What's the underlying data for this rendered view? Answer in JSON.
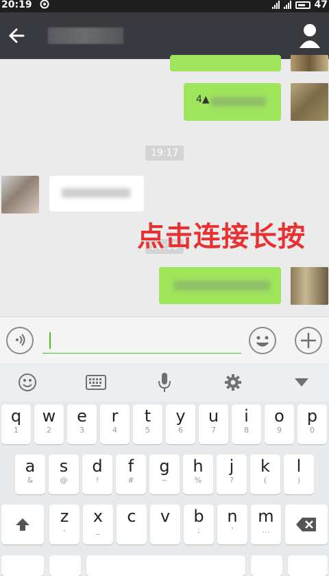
{
  "status_bar": {
    "time": "20:19",
    "battery": "47",
    "left_icon": "circle-loop-icon",
    "signal_icons": [
      "wifi-signal-icon",
      "cell-signal-icon"
    ],
    "battery_icon": "battery-icon"
  },
  "nav": {
    "back_icon": "arrow-left-icon",
    "title": "",
    "profile_icon": "person-icon"
  },
  "chat": {
    "sent_text_1": "4▲",
    "timestamps": [
      "19:17",
      "20:19"
    ],
    "overlay_annotation": "点击连接长按"
  },
  "input_bar": {
    "voice_icon": "voice-icon",
    "emoji_icon": "emoji-icon",
    "plus_icon": "plus-icon",
    "text_value": ""
  },
  "keyboard_toolbar": {
    "icons": [
      "emoji-icon",
      "keyboard-icon",
      "microphone-icon",
      "gear-icon",
      "collapse-icon"
    ]
  },
  "keyboard": {
    "row1": [
      [
        "q",
        "1"
      ],
      [
        "w",
        "2"
      ],
      [
        "e",
        "3"
      ],
      [
        "r",
        "4"
      ],
      [
        "t",
        "5"
      ],
      [
        "y",
        "6"
      ],
      [
        "u",
        "7"
      ],
      [
        "i",
        "8"
      ],
      [
        "o",
        "9"
      ],
      [
        "p",
        "0"
      ]
    ],
    "row2": [
      [
        "a",
        "&"
      ],
      [
        "s",
        "@"
      ],
      [
        "d",
        "!"
      ],
      [
        "f",
        "#"
      ],
      [
        "g",
        "~"
      ],
      [
        "h",
        "%"
      ],
      [
        "j",
        "?"
      ],
      [
        "k",
        "("
      ],
      [
        "l",
        ")"
      ]
    ],
    "row3": [
      [
        "z",
        "-"
      ],
      [
        "x",
        "_"
      ],
      [
        "c",
        ""
      ],
      [
        "v",
        ""
      ],
      [
        "b",
        ";"
      ],
      [
        "n",
        "'"
      ],
      [
        "m",
        "…"
      ]
    ],
    "shift_icon": "shift-arrow-icon",
    "delete_icon": "backspace-icon"
  },
  "colors": {
    "nav_bg": "#393a3f",
    "sent_bubble": "#9ee55c",
    "accent_green": "#45c01a",
    "annotation_red": "#e63232"
  }
}
